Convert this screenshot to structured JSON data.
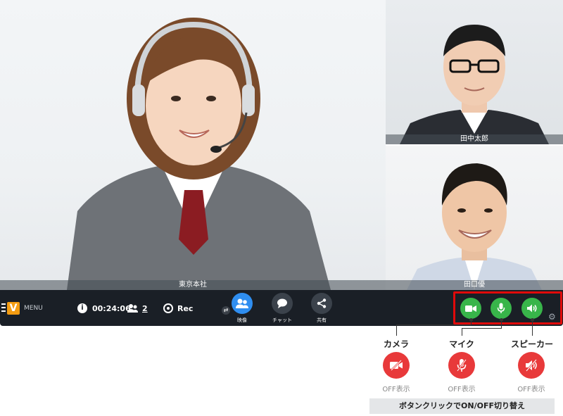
{
  "tiles": {
    "main_label": "東京本社",
    "tile2_label": "田中太郎",
    "tile3_label": "田口優"
  },
  "toolbar": {
    "logo_letter": "V",
    "menu_label": "MENU",
    "info_icon": "i",
    "timer": "00:24:06",
    "participant_count": "2",
    "rec_label": "Rec",
    "video_label": "映像",
    "chat_label": "チャット",
    "share_label": "共有",
    "accent_color": "#2f8ef0",
    "toggle_on_color": "#38b54a"
  },
  "annotations": {
    "camera_title": "カメラ",
    "mic_title": "マイク",
    "speaker_title": "スピーカー",
    "camera_off": "OFF表示",
    "mic_off": "OFF表示",
    "speaker_off": "OFF表示",
    "off_color": "#e8393a",
    "highlight_color": "#e00a0a",
    "note": "ボタンクリックでON/OFF切り替え"
  }
}
